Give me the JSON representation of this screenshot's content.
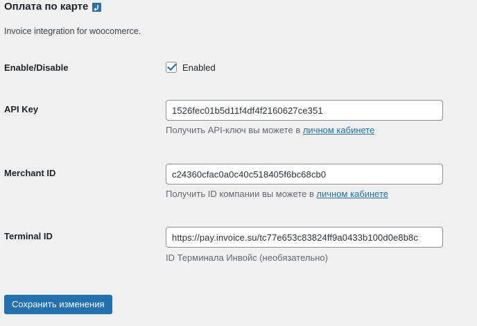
{
  "header": {
    "title": "Оплата по карте",
    "return_icon": "return-arrow-icon"
  },
  "description": "Invoice integration for woocomerce.",
  "fields": {
    "enable": {
      "label": "Enable/Disable",
      "checkbox_label": "Enabled",
      "checked": true
    },
    "api_key": {
      "label": "API Key",
      "value": "1526fec01b5d11f4df4f2160627ce351",
      "help_text": "Получить API-ключ вы можете в ",
      "help_link": "личном кабинете"
    },
    "merchant_id": {
      "label": "Merchant ID",
      "value": "c24360cfac0a0c40c518405f6bc68cb0",
      "help_text": "Получить ID компании вы можете в ",
      "help_link": "личном кабинете"
    },
    "terminal_id": {
      "label": "Terminal ID",
      "value": "https://pay.invoice.su/tc77e653c83824ff9a0433b100d0e8b8c",
      "help_text": "ID Терминала Инвойс (необязательно)"
    }
  },
  "actions": {
    "save_label": "Сохранить изменения"
  },
  "colors": {
    "accent": "#2271b1",
    "background": "#f0f0f1",
    "text": "#1d2327",
    "muted": "#646970"
  }
}
